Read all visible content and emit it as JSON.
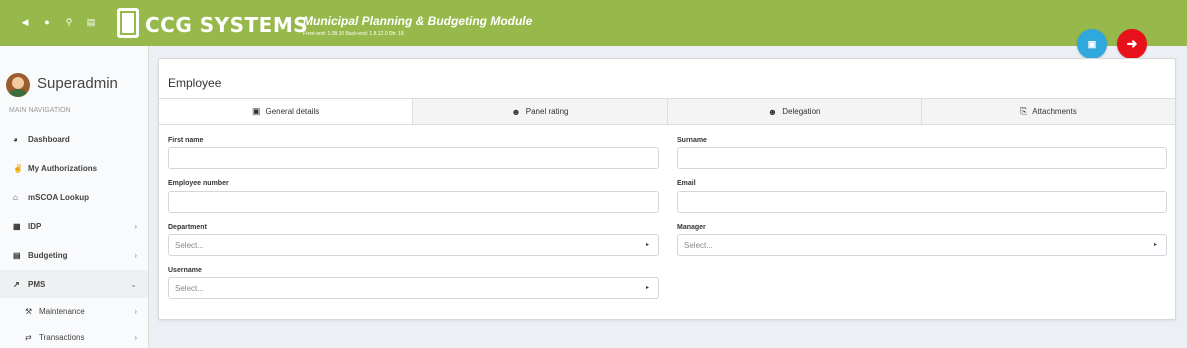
{
  "topbar": {
    "brand": "CCG SYSTEMS",
    "module_title": "Municipal Planning & Budgeting Module",
    "version": "Front-end: 1.08.10 Back-end: 1.8.12.0 Db: 18",
    "icons": [
      "arrow-left-icon",
      "lock-icon",
      "map-marker-icon",
      "id-card-icon"
    ],
    "save_icon": "💾",
    "back_icon": "➔"
  },
  "sidebar": {
    "user_name": "Superadmin",
    "nav_heading": "MAIN NAVIGATION",
    "items": [
      {
        "label": "Dashboard",
        "icon": "◕",
        "chevron": ""
      },
      {
        "label": "My Authorizations",
        "icon": "✌",
        "chevron": ""
      },
      {
        "label": "mSCOA Lookup",
        "icon": "⌂",
        "chevron": ""
      },
      {
        "label": "IDP",
        "icon": "▦",
        "chevron": "›"
      },
      {
        "label": "Budgeting",
        "icon": "▤",
        "chevron": "›"
      },
      {
        "label": "PMS",
        "icon": "↗",
        "chevron": "⌄"
      }
    ],
    "sub_items": [
      {
        "label": "Maintenance",
        "icon": "⚒",
        "chevron": "›"
      },
      {
        "label": "Transactions",
        "icon": "⇄",
        "chevron": "›"
      }
    ]
  },
  "panel": {
    "title": "Employee",
    "tabs": [
      {
        "label": "General details",
        "icon": "▣"
      },
      {
        "label": "Panel rating",
        "icon": "☻"
      },
      {
        "label": "Delegation",
        "icon": "☻"
      },
      {
        "label": "Attachments",
        "icon": "⎘"
      }
    ],
    "fields": {
      "first_name": {
        "label": "First name",
        "value": ""
      },
      "surname": {
        "label": "Surname",
        "value": ""
      },
      "employee_number": {
        "label": "Employee number",
        "value": ""
      },
      "email": {
        "label": "Email",
        "value": ""
      },
      "department": {
        "label": "Department",
        "value": "Select..."
      },
      "manager": {
        "label": "Manager",
        "value": "Select..."
      },
      "username": {
        "label": "Username",
        "value": "Select..."
      }
    },
    "caret": "▸"
  },
  "colors": {
    "topbar": "#97b84b",
    "save_button": "#2fa8dd",
    "back_button": "#e8101a"
  }
}
